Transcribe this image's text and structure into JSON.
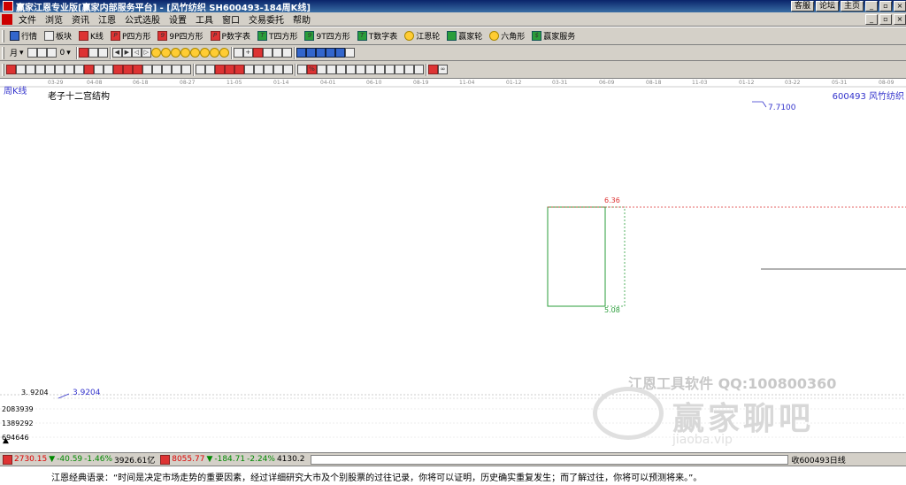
{
  "titlebar": {
    "title": "赢家江恩专业版[赢家内部服务平台] - [风竹纺织  SH600493-184周K线]",
    "btn_customer": "客服",
    "btn_forum": "论坛",
    "btn_home": "主页"
  },
  "menu": [
    "文件",
    "浏览",
    "资讯",
    "江恩",
    "公式选股",
    "设置",
    "工具",
    "窗口",
    "交易委托",
    "帮助"
  ],
  "toolbar1": [
    {
      "label": "行情",
      "icon": "grid-icon"
    },
    {
      "label": "板块",
      "icon": "blocks-icon"
    },
    {
      "label": "K线",
      "icon": "candle-icon"
    },
    {
      "label": "P四方形",
      "icon": "p-square-icon"
    },
    {
      "label": "9P四方形",
      "icon": "9p-square-icon"
    },
    {
      "label": "P数字表",
      "icon": "p-table-icon"
    },
    {
      "label": "T四方形",
      "icon": "t-square-icon"
    },
    {
      "label": "9T四方形",
      "icon": "9t-square-icon"
    },
    {
      "label": "T数字表",
      "icon": "t-table-icon"
    },
    {
      "label": "江恩轮",
      "icon": "gann-wheel-icon"
    },
    {
      "label": "赢家轮",
      "icon": "winner-wheel-icon"
    },
    {
      "label": "六角形",
      "icon": "hexagon-icon"
    },
    {
      "label": "赢家服务",
      "icon": "service-icon"
    }
  ],
  "toolbar2": {
    "period": "月",
    "unit": "0"
  },
  "chart": {
    "period_label": "周K线",
    "study_title": "老子十二宫结构",
    "stock_label": "600493  风竹纺织",
    "dates": [
      "03-29",
      "04-08",
      "06-18",
      "08-27",
      "11-05",
      "01-14",
      "04-01",
      "06-10",
      "08-19",
      "11-04",
      "01-12",
      "03-31",
      "06-09",
      "08-18",
      "11-03",
      "01-12",
      "03-22",
      "05-31",
      "08-09"
    ],
    "high_value": "7.7100",
    "low_value": "3.9204",
    "left_axis_low": "3. 9204",
    "level_upper": "6.36",
    "level_lower": "5.08",
    "volume_axis": [
      "2083939",
      "1389292",
      "694646"
    ],
    "watermark_top": "江恩工具软件   QQ:100800360",
    "watermark_main": "赢家聊吧",
    "watermark_url": "jiaoba.vip"
  },
  "status": {
    "index1_value": "2730.15",
    "index1_change": "-40.59",
    "index1_pct": "-1.46%",
    "index1_amount": "3926.61亿",
    "index2_value": "8055.77",
    "index2_change": "-184.71",
    "index2_pct": "-2.24%",
    "index2_amount": "4130.2",
    "right_text": "收600493日线"
  },
  "quote": "江恩经典语录：“时间是决定市场走势的重要因素，经过详细研究大市及个别股票的过往记录，你将可以证明，历史确实重复发生；而了解过往，你将可以预测将来。”。"
}
